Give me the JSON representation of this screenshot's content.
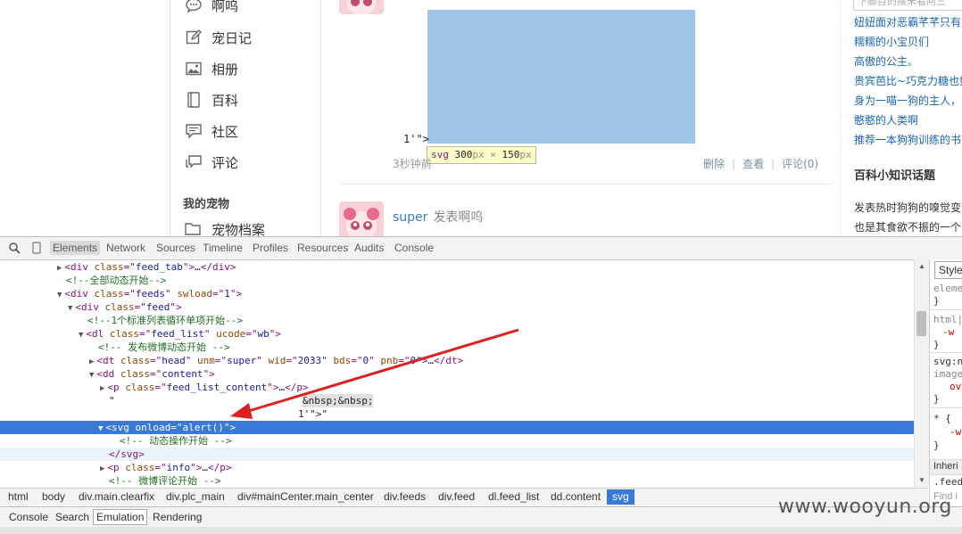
{
  "left_nav": {
    "items": [
      {
        "label": "啊呜",
        "icon": "speech-bubble-icon"
      },
      {
        "label": "宠日记",
        "icon": "edit-icon"
      },
      {
        "label": "相册",
        "icon": "image-icon"
      },
      {
        "label": "百科",
        "icon": "book-icon"
      },
      {
        "label": "社区",
        "icon": "chat-icon"
      },
      {
        "label": "评论",
        "icon": "comment-icon"
      }
    ],
    "my_pets_heading": "我的宠物",
    "pet_archive_label": "宠物档案"
  },
  "feed": {
    "quote_text": "1'\">",
    "tooltip": {
      "tag": "svg",
      "width": "300",
      "height": "150",
      "unit": "px",
      "times": "×"
    },
    "time_ago": "3秒钟前",
    "actions": [
      "删除",
      "查看",
      "评论(0)"
    ],
    "next_post": {
      "user": "super",
      "action": "发表啊呜"
    }
  },
  "right_col": {
    "search_placeholder": "下脚目的接米看阿三",
    "links": [
      "妞妞面对恶霸芊芊只有",
      "糯糯的小宝贝们",
      "高傲的公主。",
      "贵宾芭比~巧克力糖也如",
      "身为一喵一狗的主人，",
      "憨憨的人类啊",
      "推荐一本狗狗训练的书"
    ],
    "heading": "百科小知识话题",
    "texts": [
      "发表热时狗狗的嗅觉变",
      "也是其食欲不振的一个"
    ]
  },
  "devtools": {
    "tabs": [
      "Elements",
      "Network",
      "Sources",
      "Timeline",
      "Profiles",
      "Resources",
      "Audits",
      "Console"
    ],
    "dom_lines": [
      {
        "indent": 64,
        "tri": "▶",
        "parts": [
          [
            "tag",
            "<div "
          ],
          [
            "attr",
            "class"
          ],
          [
            "tag",
            "=\""
          ],
          [
            "val",
            "feed_tab"
          ],
          [
            "tag",
            "\">"
          ],
          [
            "plain",
            "…"
          ],
          [
            "tag",
            "</div>"
          ]
        ]
      },
      {
        "indent": 74,
        "tri": "",
        "parts": [
          [
            "cmt",
            "<!--全部动态开始-->"
          ]
        ]
      },
      {
        "indent": 64,
        "tri": "▼",
        "parts": [
          [
            "tag",
            "<div "
          ],
          [
            "attr",
            "class"
          ],
          [
            "tag",
            "=\""
          ],
          [
            "val",
            "feeds"
          ],
          [
            "tag",
            "\" "
          ],
          [
            "attr",
            "swload"
          ],
          [
            "tag",
            "=\""
          ],
          [
            "val",
            "1"
          ],
          [
            "tag",
            "\">"
          ]
        ]
      },
      {
        "indent": 76,
        "tri": "▼",
        "parts": [
          [
            "tag",
            "<div "
          ],
          [
            "attr",
            "class"
          ],
          [
            "tag",
            "=\""
          ],
          [
            "val",
            "feed"
          ],
          [
            "tag",
            "\">"
          ]
        ]
      },
      {
        "indent": 98,
        "tri": "",
        "parts": [
          [
            "cmt",
            "<!--1个标准列表循环单项开始-->"
          ]
        ]
      },
      {
        "indent": 88,
        "tri": "▼",
        "parts": [
          [
            "tag",
            "<dl "
          ],
          [
            "attr",
            "class"
          ],
          [
            "tag",
            "=\""
          ],
          [
            "val",
            "feed_list"
          ],
          [
            "tag",
            "\" "
          ],
          [
            "attr",
            "ucode"
          ],
          [
            "tag",
            "=\""
          ],
          [
            "val",
            "wb"
          ],
          [
            "tag",
            "\">"
          ]
        ]
      },
      {
        "indent": 110,
        "tri": "",
        "parts": [
          [
            "cmt",
            "<!-- 发布微博动态开始 -->"
          ]
        ]
      },
      {
        "indent": 100,
        "tri": "▶",
        "parts": [
          [
            "tag",
            "<dt "
          ],
          [
            "attr",
            "class"
          ],
          [
            "tag",
            "=\""
          ],
          [
            "val",
            "head"
          ],
          [
            "tag",
            "\" "
          ],
          [
            "attr",
            "unm"
          ],
          [
            "tag",
            "=\""
          ],
          [
            "val",
            "super"
          ],
          [
            "tag",
            "\" "
          ],
          [
            "attr",
            "wid"
          ],
          [
            "tag",
            "=\""
          ],
          [
            "val",
            "2033"
          ],
          [
            "tag",
            "\" "
          ],
          [
            "attr",
            "bds"
          ],
          [
            "tag",
            "=\""
          ],
          [
            "val",
            "0"
          ],
          [
            "tag",
            "\" "
          ],
          [
            "attr",
            "pnb"
          ],
          [
            "tag",
            "=\""
          ],
          [
            "val",
            "0"
          ],
          [
            "tag",
            "\">"
          ],
          [
            "plain",
            "…"
          ],
          [
            "tag",
            "</dt>"
          ]
        ]
      },
      {
        "indent": 100,
        "tri": "▼",
        "parts": [
          [
            "tag",
            "<dd "
          ],
          [
            "attr",
            "class"
          ],
          [
            "tag",
            "=\""
          ],
          [
            "val",
            "content"
          ],
          [
            "tag",
            "\">"
          ]
        ]
      },
      {
        "indent": 112,
        "tri": "▶",
        "parts": [
          [
            "tag",
            "<p "
          ],
          [
            "attr",
            "class"
          ],
          [
            "tag",
            "=\""
          ],
          [
            "val",
            "feed_list_content"
          ],
          [
            "tag",
            "\">"
          ],
          [
            "plain",
            "…"
          ],
          [
            "tag",
            "</p>"
          ]
        ]
      },
      {
        "indent": 122,
        "tri": "",
        "parts": [
          [
            "plain",
            "\""
          ]
        ],
        "extra": "&nbsp;&nbsp;"
      },
      {
        "indent": 334,
        "tri": "",
        "parts": [
          [
            "plain",
            "1'\">\""
          ]
        ]
      },
      {
        "indent": 110,
        "tri": "▼",
        "selected": true,
        "parts": [
          [
            "tag",
            "<svg "
          ],
          [
            "attr",
            "onload"
          ],
          [
            "tag",
            "=\""
          ],
          [
            "val",
            "alert()"
          ],
          [
            "tag",
            "\">"
          ]
        ]
      },
      {
        "indent": 134,
        "tri": "",
        "parts": [
          [
            "cmt",
            "<!-- 动态操作开始 -->"
          ]
        ]
      },
      {
        "indent": 122,
        "tri": "",
        "hover": true,
        "parts": [
          [
            "tag",
            "</svg>"
          ]
        ]
      },
      {
        "indent": 112,
        "tri": "▶",
        "parts": [
          [
            "tag",
            "<p "
          ],
          [
            "attr",
            "class"
          ],
          [
            "tag",
            "=\""
          ],
          [
            "val",
            "info"
          ],
          [
            "tag",
            "\">"
          ],
          [
            "plain",
            "…"
          ],
          [
            "tag",
            "</p>"
          ]
        ]
      },
      {
        "indent": 122,
        "tri": "",
        "parts": [
          [
            "cmt",
            "<!-- 微博评论开始 -->"
          ]
        ]
      }
    ],
    "breadcrumbs": [
      "html",
      "body",
      "div.main.clearfix",
      "div.plc_main",
      "div#mainCenter.main_center",
      "div.feeds",
      "div.feed",
      "dl.feed_list",
      "dd.content",
      "svg"
    ],
    "styles_tab": "Styles",
    "styles_lines": [
      "eleme",
      "}",
      "html|",
      "-w",
      "}",
      "svg:n",
      "image",
      "ov",
      "}",
      "* {",
      "-w",
      "}",
      "Inheri",
      ".feed",
      "Find i"
    ],
    "drawer_tabs": [
      "Console",
      "Search",
      "Emulation",
      "Rendering"
    ]
  },
  "watermark": "www.wooyun.org"
}
